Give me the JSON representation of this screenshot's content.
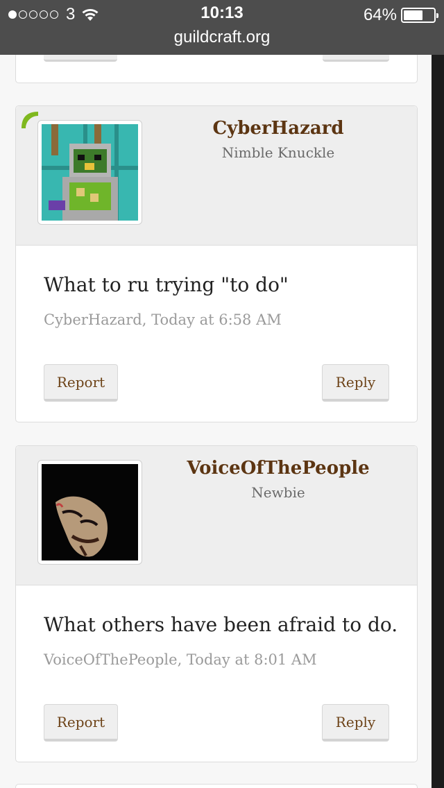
{
  "status_bar": {
    "carrier": "3",
    "time": "10:13",
    "battery_percent": "64%",
    "battery_level": 0.64,
    "url": "guildcraft.org"
  },
  "posts": [
    {
      "username": "CyberHazard",
      "user_title": "Nimble Knuckle",
      "message": "What to ru trying \"to do\"",
      "meta": "CyberHazard, Today at 6:58 AM",
      "report_label": "Report",
      "reply_label": "Reply",
      "online": true
    },
    {
      "username": "VoiceOfThePeople",
      "user_title": "Newbie",
      "message": "What others have been afraid to do.",
      "meta": "VoiceOfThePeople, Today at 8:01 AM",
      "report_label": "Report",
      "reply_label": "Reply",
      "online": false
    }
  ],
  "colors": {
    "status_bar_bg": "#4d4d4d",
    "username": "#5c3512",
    "button_text": "#6d4318",
    "online_indicator": "#7fb81f"
  }
}
